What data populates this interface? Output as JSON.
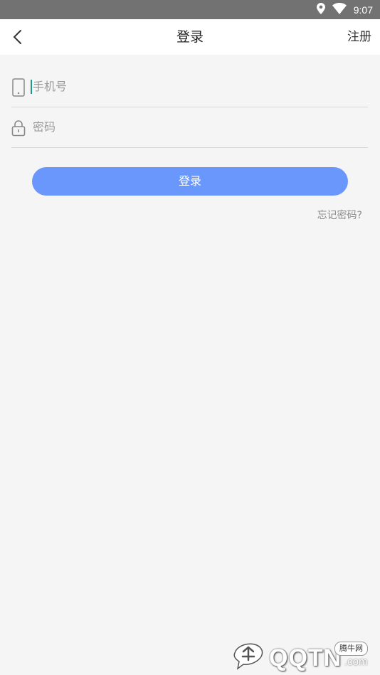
{
  "status_bar": {
    "time": "9:07"
  },
  "header": {
    "title": "登录",
    "register_label": "注册"
  },
  "form": {
    "phone_placeholder": "手机号",
    "password_placeholder": "密码",
    "login_label": "登录",
    "forgot_label": "忘记密码?"
  },
  "watermark": {
    "text": "QQTN",
    "suffix": ".com",
    "badge": "腾牛网"
  },
  "colors": {
    "accent": "#6a97fb",
    "status_bar": "#727272",
    "background": "#f5f5f5"
  }
}
